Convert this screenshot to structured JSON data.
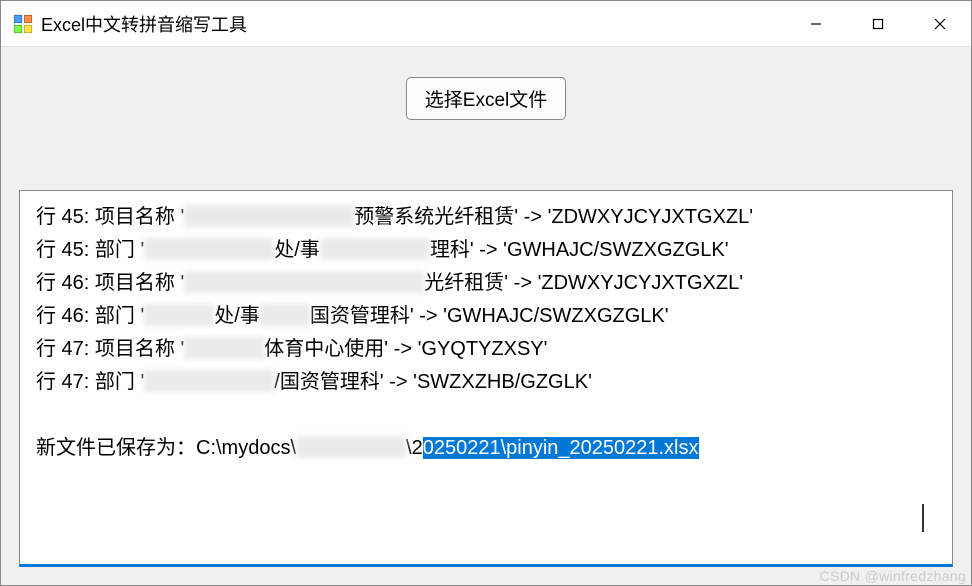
{
  "window": {
    "title": "Excel中文转拼音缩写工具"
  },
  "actions": {
    "select_file_label": "选择Excel文件"
  },
  "log": {
    "lines": [
      {
        "row": "行 45:",
        "field": "项目名称",
        "redact_w": 170,
        "suffix": "预警系统光纤租赁'",
        "arrow": " -> ",
        "result": "'ZDWXYJCYJXTGXZL'"
      },
      {
        "row": "行 45:",
        "field": "部门",
        "redact_w1": 130,
        "mid": "处/事",
        "redact_w2": 110,
        "suffix": "理科'",
        "arrow": " -> ",
        "result": "'GWHAJC/SWZXGZGLK'"
      },
      {
        "row": "行 46:",
        "field": "项目名称",
        "redact_w": 240,
        "suffix": "光纤租赁'",
        "arrow": " -> ",
        "result": "'ZDWXYJCYJXTGXZL'"
      },
      {
        "row": "行 46:",
        "field": "部门",
        "redact_w1": 70,
        "mid": "处/事",
        "redact_w2": 50,
        "suffix": "国资管理科'",
        "arrow": " -> ",
        "result": "'GWHAJC/SWZXGZGLK'"
      },
      {
        "row": "行 47:",
        "field": "项目名称",
        "redact_w": 80,
        "suffix": "体育中心使用'",
        "arrow": " -> ",
        "result": "'GYQTYZXSY'"
      },
      {
        "row": "行 47:",
        "field": "部门",
        "redact_w1": 130,
        "mid": "",
        "redact_w2": 0,
        "suffix": "/国资管理科'",
        "arrow": " -> ",
        "result": "'SWZXZHB/GZGLK'"
      }
    ],
    "saved_prefix": "新文件已保存为：C:\\mydocs\\",
    "saved_mid": "\\2",
    "saved_selected": "0250221\\pinyin_20250221.xlsx"
  },
  "watermark": "CSDN @winfredzhang"
}
